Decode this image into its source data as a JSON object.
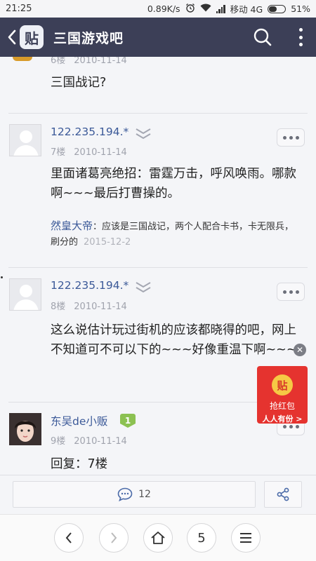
{
  "status_bar": {
    "time": "21:25",
    "network_speed": "0.89K/s",
    "carrier": "移动 4G",
    "battery": "51%",
    "battery_level": 0.51
  },
  "nav": {
    "logo_text": "贴",
    "title": "三国游戏吧"
  },
  "posts": [
    {
      "floor": "6楼",
      "date": "2010-11-14",
      "text": "三国战记?"
    },
    {
      "username": "122.235.194.*",
      "floor": "7楼",
      "date": "2010-11-14",
      "text": "里面诸葛亮绝招：雷霆万击，呼风唤雨。哪款啊~~~最后打曹操的。",
      "reply": {
        "user": "然皇大帝",
        "text": "应该是三国战记，两个人配合卡书，卡无限兵，刷分的",
        "date": "2015-12-2"
      }
    },
    {
      "username": "122.235.194.*",
      "floor": "8楼",
      "date": "2010-11-14",
      "text": "这么说估计玩过街机的应该都晓得的吧，网上不知道可不可以下的~~~好像重温下啊~~~"
    },
    {
      "username": "东吴de小贩",
      "level": "1",
      "floor": "9楼",
      "date": "2010-11-14",
      "text": "回复：7楼"
    }
  ],
  "red_packet": {
    "coin": "贴",
    "line1": "抢红包",
    "line2": "人人有份 >"
  },
  "comment_bar": {
    "count": "12"
  },
  "browser": {
    "tab_count": "5"
  },
  "colors": {
    "nav_bg": "#3c3f57",
    "link_blue": "#3b5998",
    "red_packet": "#e5332f"
  }
}
